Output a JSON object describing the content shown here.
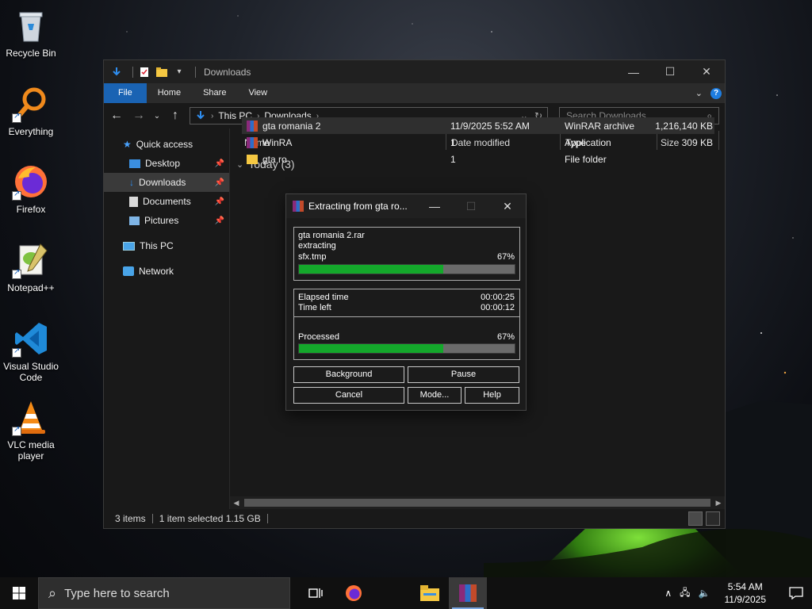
{
  "desktop": {
    "icons": [
      {
        "label": "Recycle Bin",
        "icon": "recycle-bin-icon"
      },
      {
        "label": "Everything",
        "icon": "everything-search-icon"
      },
      {
        "label": "Firefox",
        "icon": "firefox-icon"
      },
      {
        "label": "Notepad++",
        "icon": "notepad-plus-plus-icon"
      },
      {
        "label": "Visual Studio Code",
        "icon": "vscode-icon"
      },
      {
        "label": "VLC media player",
        "icon": "vlc-icon"
      }
    ]
  },
  "explorer": {
    "title": "Downloads",
    "ribbon_tabs": [
      "File",
      "Home",
      "Share",
      "View"
    ],
    "breadcrumb": [
      "This PC",
      "Downloads"
    ],
    "search_placeholder": "Search Downloads",
    "nav": {
      "quick_access": "Quick access",
      "desktop": "Desktop",
      "downloads": "Downloads",
      "documents": "Documents",
      "pictures": "Pictures",
      "this_pc": "This PC",
      "network": "Network"
    },
    "columns": {
      "name": "Name",
      "date": "Date modified",
      "type": "Type",
      "size": "Size"
    },
    "group_label": "Today (3)",
    "files": [
      {
        "name": "gta romania 2",
        "date": "11/9/2025 5:52 AM",
        "type": "WinRAR archive",
        "size": "1,216,140 KB",
        "selected": true
      },
      {
        "name": "WinRA",
        "date": "1",
        "type": "Application",
        "size": "309 KB",
        "selected": false
      },
      {
        "name": "gta ro",
        "date": "1",
        "type": "File folder",
        "size": "",
        "selected": false
      }
    ],
    "status": {
      "items": "3 items",
      "selected": "1 item selected  1.15 GB"
    }
  },
  "winrar": {
    "title": "Extracting from gta ro...",
    "archive": "gta romania 2.rar",
    "action": "extracting",
    "current_file": "sfx.tmp",
    "file_progress_label": "67%",
    "file_progress": 0.67,
    "elapsed_label": "Elapsed time",
    "elapsed_value": "00:00:25",
    "timeleft_label": "Time left",
    "timeleft_value": "00:00:12",
    "processed_label": "Processed",
    "processed_progress_label": "67%",
    "processed_progress": 0.67,
    "buttons": {
      "background": "Background",
      "pause": "Pause",
      "cancel": "Cancel",
      "mode": "Mode...",
      "help": "Help"
    }
  },
  "taskbar": {
    "search_placeholder": "Type here to search",
    "time": "5:54 AM",
    "date": "11/9/2025"
  },
  "colors": {
    "accent": "#1a63b3",
    "progress_fill": "#14a82b",
    "progress_track": "#6b6b6b"
  }
}
